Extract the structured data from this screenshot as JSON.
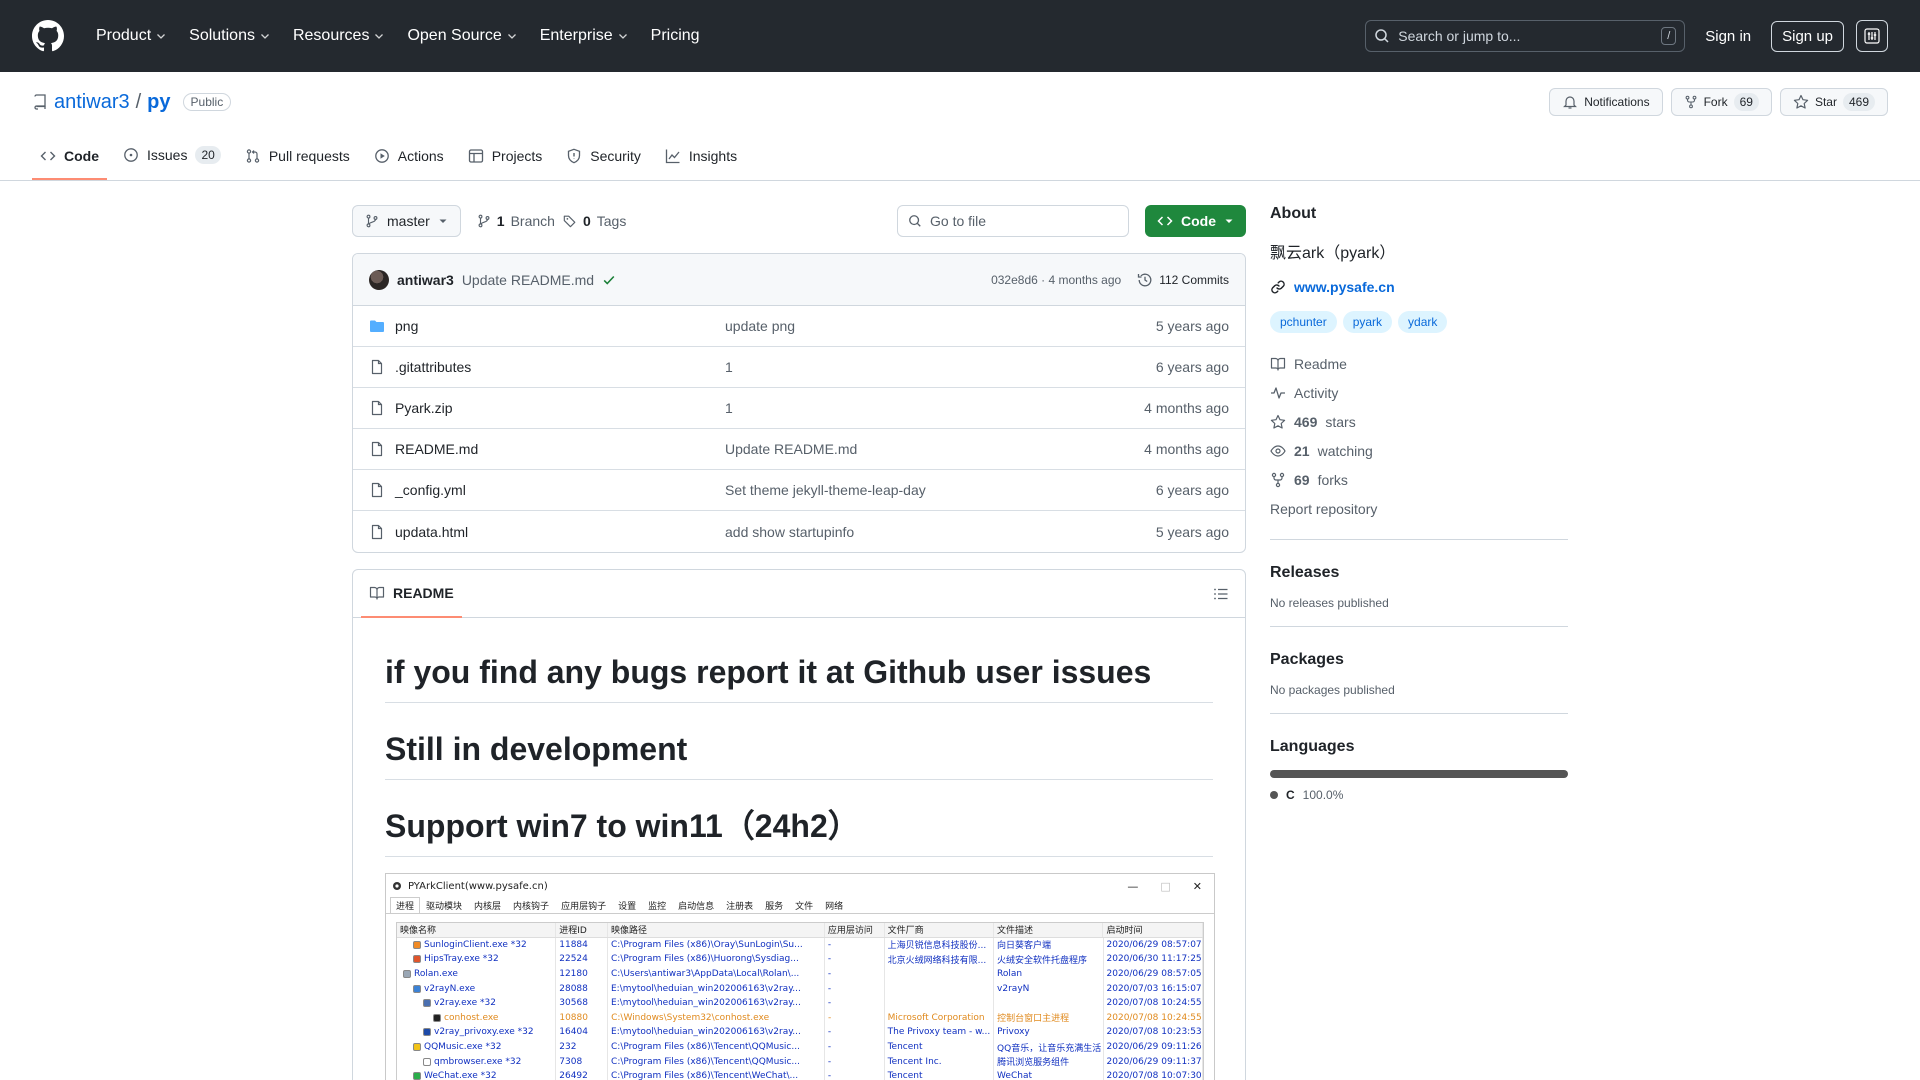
{
  "header": {
    "nav": [
      "Product",
      "Solutions",
      "Resources",
      "Open Source",
      "Enterprise",
      "Pricing"
    ],
    "search_placeholder": "Search or jump to...",
    "search_key": "/",
    "signin": "Sign in",
    "signup": "Sign up"
  },
  "repo": {
    "owner": "antiwar3",
    "sep": "/",
    "name": "py",
    "visibility": "Public",
    "notifications": "Notifications",
    "fork_label": "Fork",
    "fork_count": "69",
    "star_label": "Star",
    "star_count": "469",
    "tabs": [
      {
        "label": "Code",
        "count": ""
      },
      {
        "label": "Issues",
        "count": "20"
      },
      {
        "label": "Pull requests",
        "count": ""
      },
      {
        "label": "Actions",
        "count": ""
      },
      {
        "label": "Projects",
        "count": ""
      },
      {
        "label": "Security",
        "count": ""
      },
      {
        "label": "Insights",
        "count": ""
      }
    ]
  },
  "filenav": {
    "branch": "master",
    "branch_count": "1",
    "branch_label": "Branch",
    "tag_count": "0",
    "tag_label": "Tags",
    "goto_placeholder": "Go to file",
    "code_button": "Code"
  },
  "commit": {
    "author": "antiwar3",
    "message": "Update README.md",
    "hash": "032e8d6",
    "dot": "·",
    "age": "4 months ago",
    "commits": "112 Commits"
  },
  "files": [
    {
      "name": "png",
      "type": "dir",
      "message": "update png",
      "age": "5 years ago"
    },
    {
      "name": ".gitattributes",
      "type": "file",
      "message": "1",
      "age": "6 years ago"
    },
    {
      "name": "Pyark.zip",
      "type": "file",
      "message": "1",
      "age": "4 months ago"
    },
    {
      "name": "README.md",
      "type": "file",
      "message": "Update README.md",
      "age": "4 months ago"
    },
    {
      "name": "_config.yml",
      "type": "file",
      "message": "Set theme jekyll-theme-leap-day",
      "age": "6 years ago"
    },
    {
      "name": "updata.html",
      "type": "file",
      "message": "add show startupinfo",
      "age": "5 years ago"
    }
  ],
  "readme": {
    "tab": "README",
    "headings": [
      "if you find any bugs report it at Github user issues",
      "Still in development",
      "Support win7 to win11（24h2）"
    ],
    "screenshot": {
      "title": "PYArkClient(www.pysafe.cn)",
      "controls": [
        "—",
        "□",
        "✕"
      ],
      "tabs": [
        "进程",
        "驱动模块",
        "内核层",
        "内核钩子",
        "应用层钩子",
        "设置",
        "监控",
        "启动信息",
        "注册表",
        "服务",
        "文件",
        "网络"
      ],
      "columns": [
        "映像名称",
        "进程ID",
        "映像路径",
        "应用层访问",
        "文件厂商",
        "文件描述",
        "启动时间"
      ],
      "rows": [
        {
          "c": [
            "SunloginClient.exe *32",
            "11884",
            "C:\\Program Files (x86)\\Oray\\SunLogin\\Su...",
            "-",
            "上海贝锐信息科技股份...",
            "向日葵客户端",
            "2020/06/29  08:57:07"
          ],
          "tone": "blue",
          "icon": "#f08a24",
          "indent": 1
        },
        {
          "c": [
            "HipsTray.exe *32",
            "22524",
            "C:\\Program Files (x86)\\Huorong\\Sysdiag...",
            "-",
            "北京火绒网络科技有限...",
            "火绒安全软件托盘程序",
            "2020/06/30  11:17:25"
          ],
          "tone": "blue",
          "icon": "#e0552b",
          "indent": 1
        },
        {
          "c": [
            "Rolan.exe",
            "12180",
            "C:\\Users\\antiwar3\\AppData\\Local\\Rolan\\...",
            "-",
            "",
            "Rolan",
            "2020/06/29  08:57:05"
          ],
          "tone": "blue",
          "icon": "#9aa7b5",
          "indent": 0
        },
        {
          "c": [
            "v2rayN.exe",
            "28088",
            "E:\\mytool\\heduian_win202006163\\v2ray...",
            "-",
            "",
            "v2rayN",
            "2020/07/03  16:15:07"
          ],
          "tone": "blue",
          "icon": "#3b82d6",
          "indent": 1
        },
        {
          "c": [
            "v2ray.exe *32",
            "30568",
            "E:\\mytool\\heduian_win202006163\\v2ray...",
            "-",
            "",
            "",
            "2020/07/08  10:24:55"
          ],
          "tone": "blue",
          "icon": "#4a6fb0",
          "indent": 2
        },
        {
          "c": [
            "conhost.exe",
            "10880",
            "C:\\Windows\\System32\\conhost.exe",
            "-",
            "Microsoft Corporation",
            "控制台窗口主进程",
            "2020/07/08  10:24:55"
          ],
          "tone": "orange",
          "icon": "#222222",
          "indent": 3
        },
        {
          "c": [
            "v2ray_privoxy.exe *32",
            "16404",
            "E:\\mytool\\heduian_win202006163\\v2ray...",
            "-",
            "The Privoxy team - w...",
            "Privoxy",
            "2020/07/08  10:23:53"
          ],
          "tone": "blue",
          "icon": "#1c4aa8",
          "indent": 2
        },
        {
          "c": [
            "QQMusic.exe *32",
            "232",
            "C:\\Program Files (x86)\\Tencent\\QQMusic...",
            "-",
            "Tencent",
            "QQ音乐，让音乐充满生活",
            "2020/06/29  09:11:26"
          ],
          "tone": "blue",
          "icon": "#f2c318",
          "indent": 1
        },
        {
          "c": [
            "qmbrowser.exe *32",
            "7308",
            "C:\\Program Files (x86)\\Tencent\\QQMusic...",
            "-",
            "Tencent Inc.",
            "腾讯浏览服务组件",
            "2020/06/29  09:11:37"
          ],
          "tone": "blue",
          "icon": "#ffffff",
          "indent": 2
        },
        {
          "c": [
            "WeChat.exe *32",
            "26492",
            "C:\\Program Files (x86)\\Tencent\\WeChat\\...",
            "-",
            "Tencent",
            "WeChat",
            "2020/07/08  10:07:30"
          ],
          "tone": "blue",
          "icon": "#2aae4a",
          "indent": 1
        }
      ]
    }
  },
  "about": {
    "heading": "About",
    "description": "飘云ark（pyark）",
    "website": "www.pysafe.cn",
    "topics": [
      "pchunter",
      "pyark",
      "ydark"
    ],
    "readme": "Readme",
    "activity": "Activity",
    "stars_count": "469",
    "stars_label": "stars",
    "watching_count": "21",
    "watching_label": "watching",
    "forks_count": "69",
    "forks_label": "forks",
    "report": "Report repository"
  },
  "releases": {
    "heading": "Releases",
    "text": "No releases published"
  },
  "packages": {
    "heading": "Packages",
    "text": "No packages published"
  },
  "languages": {
    "heading": "Languages",
    "items": [
      {
        "name": "C",
        "percent": "100.0%",
        "color": "#555555"
      }
    ]
  }
}
